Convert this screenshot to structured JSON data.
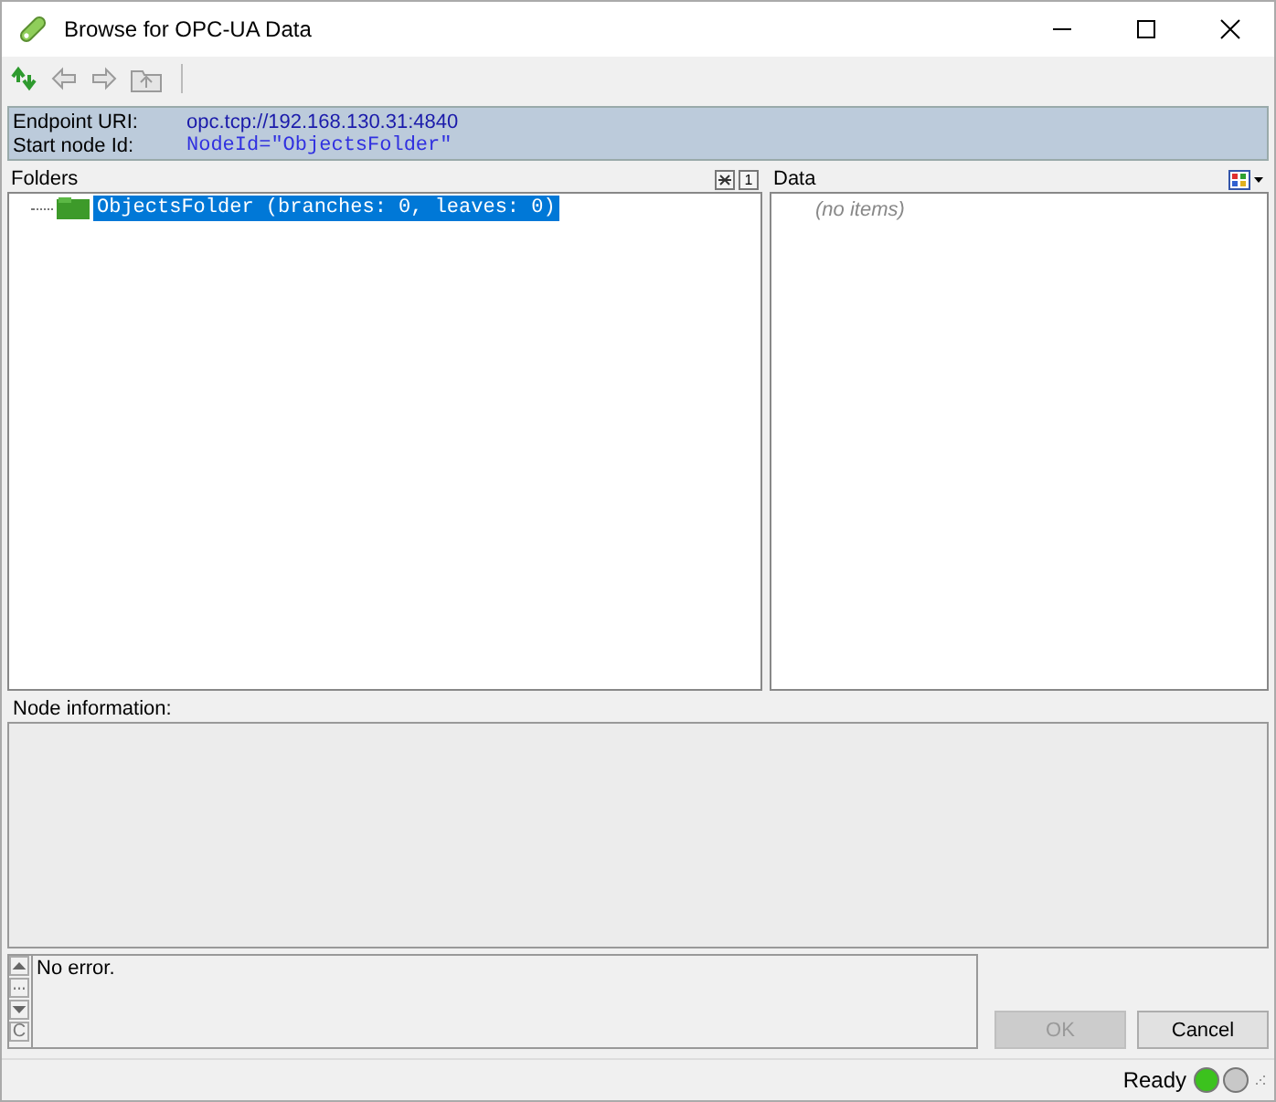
{
  "window": {
    "title": "Browse for OPC-UA Data"
  },
  "toolbar": [
    {
      "kind": "refresh",
      "disabled": false
    },
    {
      "kind": "back",
      "disabled": true
    },
    {
      "kind": "forward",
      "disabled": true
    },
    {
      "kind": "up",
      "disabled": true
    }
  ],
  "endpoint": {
    "uri_label": "Endpoint URI:",
    "uri": "opc.tcp://192.168.130.31:4840",
    "node_label": "Start node Id:",
    "node_id": "NodeId=\"ObjectsFolder\""
  },
  "folders": {
    "title": "Folders",
    "one_level_key": "1",
    "tree": [
      {
        "label": "ObjectsFolder (branches: 0, leaves: 0)",
        "selected": true
      }
    ]
  },
  "data": {
    "title": "Data",
    "empty_text": "(no items)"
  },
  "node_info": {
    "label": "Node information:"
  },
  "log": {
    "message": "No error.",
    "clear_key": "C"
  },
  "buttons": [
    {
      "label": "OK",
      "disabled": true
    },
    {
      "label": "Cancel",
      "disabled": false
    }
  ],
  "status_bar": {
    "text": "Ready",
    "lights": [
      {
        "color": "#3cc21e"
      },
      {
        "color": "#c8c8c8"
      }
    ]
  }
}
